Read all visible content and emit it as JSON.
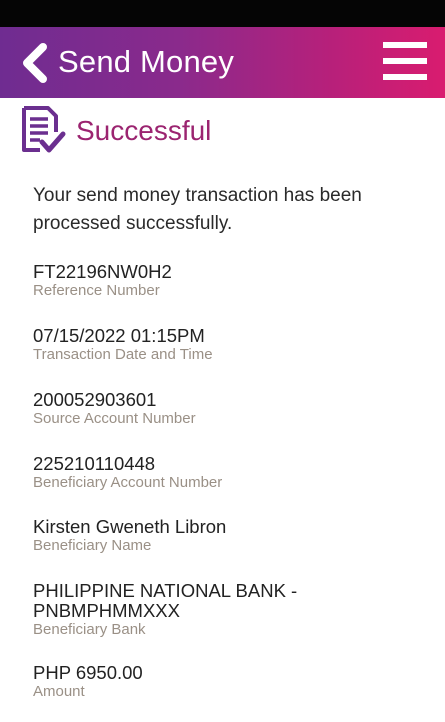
{
  "header": {
    "title": "Send Money",
    "back_icon": "chevron-left-icon",
    "menu_icon": "hamburger-menu-icon",
    "gradient_start": "#6f2c91",
    "gradient_end": "#d91c6f"
  },
  "status": {
    "title": "Successful",
    "icon": "document-check-icon",
    "color": "#9b2470"
  },
  "message": "Your send money transaction has been processed successfully.",
  "fields": [
    {
      "value": "FT22196NW0H2",
      "label": "Reference Number"
    },
    {
      "value": "07/15/2022 01:15PM",
      "label": "Transaction Date and Time"
    },
    {
      "value": "200052903601",
      "label": "Source Account Number"
    },
    {
      "value": "225210110448",
      "label": "Beneficiary Account Number"
    },
    {
      "value": "Kirsten Gweneth Libron",
      "label": "Beneficiary Name"
    },
    {
      "value": "PHILIPPINE NATIONAL BANK -\nPNBMPHMMXXX",
      "label": "Beneficiary Bank"
    },
    {
      "value": "PHP 6950.00",
      "label": "Amount"
    }
  ]
}
